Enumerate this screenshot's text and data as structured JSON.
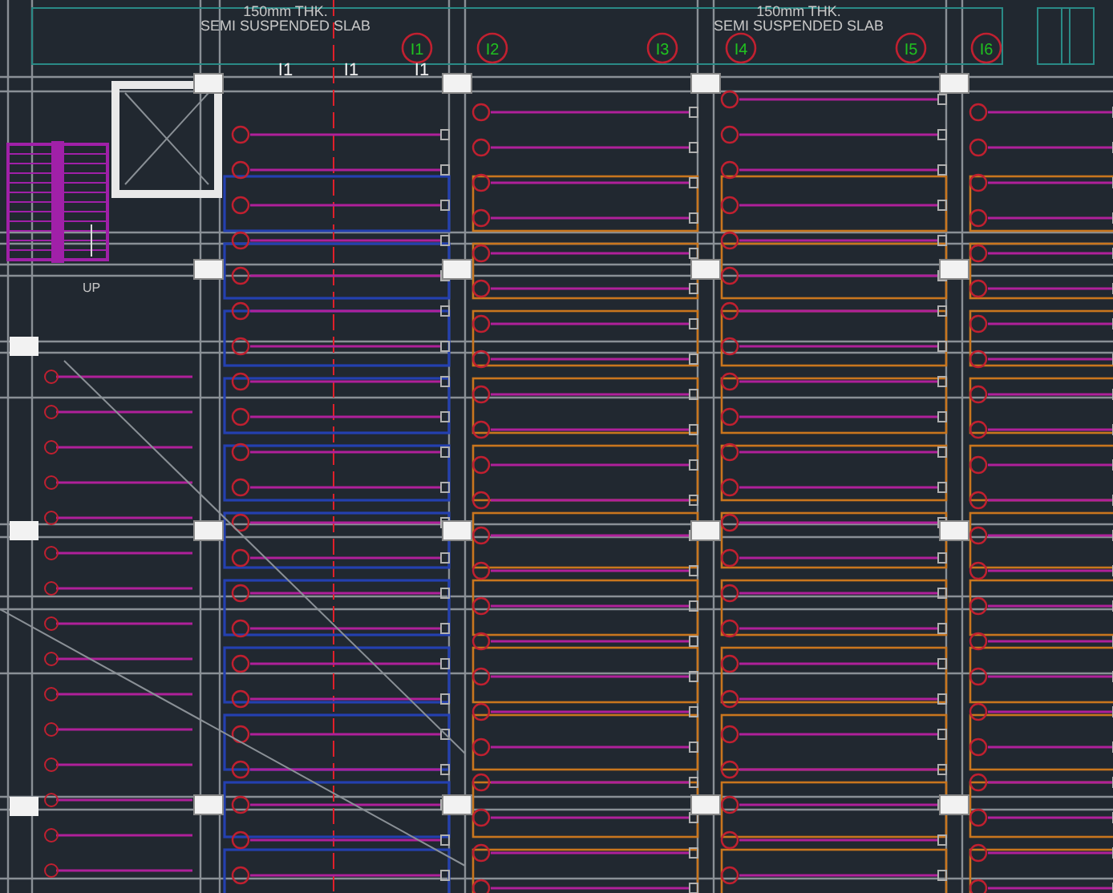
{
  "slab_notes": [
    {
      "thickness": "150mm THK.",
      "type": "SEMI SUSPENDED SLAB"
    },
    {
      "thickness": "150mm THK.",
      "type": "SEMI SUSPENDED SLAB"
    }
  ],
  "grid_bubbles": [
    "I1",
    "I2",
    "I3",
    "I4",
    "I5",
    "I6"
  ],
  "section_marks": [
    "I1",
    "I1",
    "I1"
  ],
  "stair_label": "UP"
}
